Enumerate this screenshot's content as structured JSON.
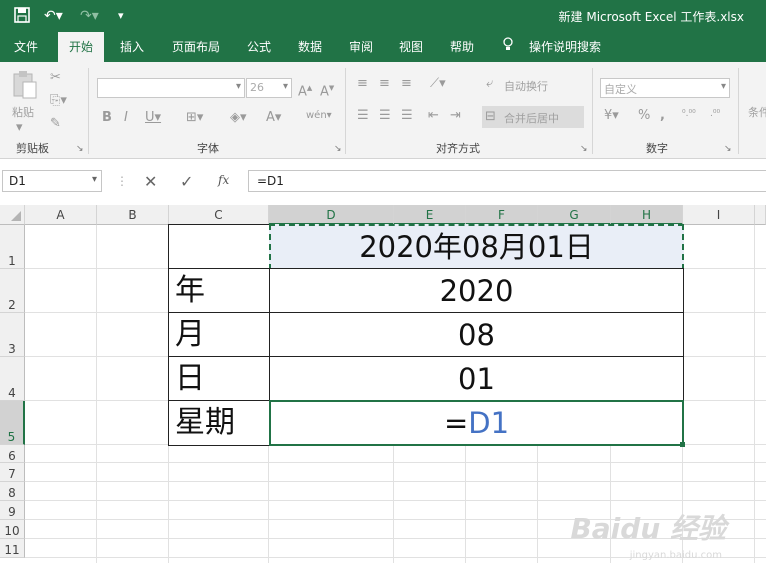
{
  "window": {
    "title": "新建 Microsoft Excel 工作表.xlsx"
  },
  "quick_access": {
    "save_icon": "save-icon",
    "undo_icon": "undo-icon",
    "redo_icon": "redo-icon",
    "customize_icon": "customize-icon"
  },
  "tabs": [
    "文件",
    "开始",
    "插入",
    "页面布局",
    "公式",
    "数据",
    "审阅",
    "视图",
    "帮助"
  ],
  "tell_me": "操作说明搜索",
  "ribbon": {
    "clipboard": {
      "label": "剪贴板",
      "paste": "粘贴"
    },
    "font": {
      "label": "字体",
      "size": "26"
    },
    "alignment": {
      "label": "对齐方式",
      "wrap": "自动换行",
      "merge": "合并后居中"
    },
    "number": {
      "label": "数字",
      "format": "自定义"
    },
    "styles": {
      "partial": "条件"
    }
  },
  "formula_bar": {
    "name_box": "D1",
    "formula": "=D1",
    "fx": "fx"
  },
  "columns": [
    "A",
    "B",
    "C",
    "D",
    "E",
    "F",
    "G",
    "H",
    "I"
  ],
  "rows": [
    "1",
    "2",
    "3",
    "4",
    "5",
    "6",
    "7",
    "8",
    "9",
    "10",
    "11"
  ],
  "cells": {
    "d1": "2020年08月01日",
    "c2": "年",
    "d2": "2020",
    "c3": "月",
    "d3": "08",
    "c4": "日",
    "d4": "01",
    "c5": "星期",
    "d5_eq": "=",
    "d5_ref": "D1"
  },
  "watermark": {
    "main": "Baidu 经验",
    "sub": "jingyan.baidu.com"
  },
  "colors": {
    "excel_green": "#217346",
    "ref_blue": "#4472c4",
    "copy_border": "#217346"
  }
}
